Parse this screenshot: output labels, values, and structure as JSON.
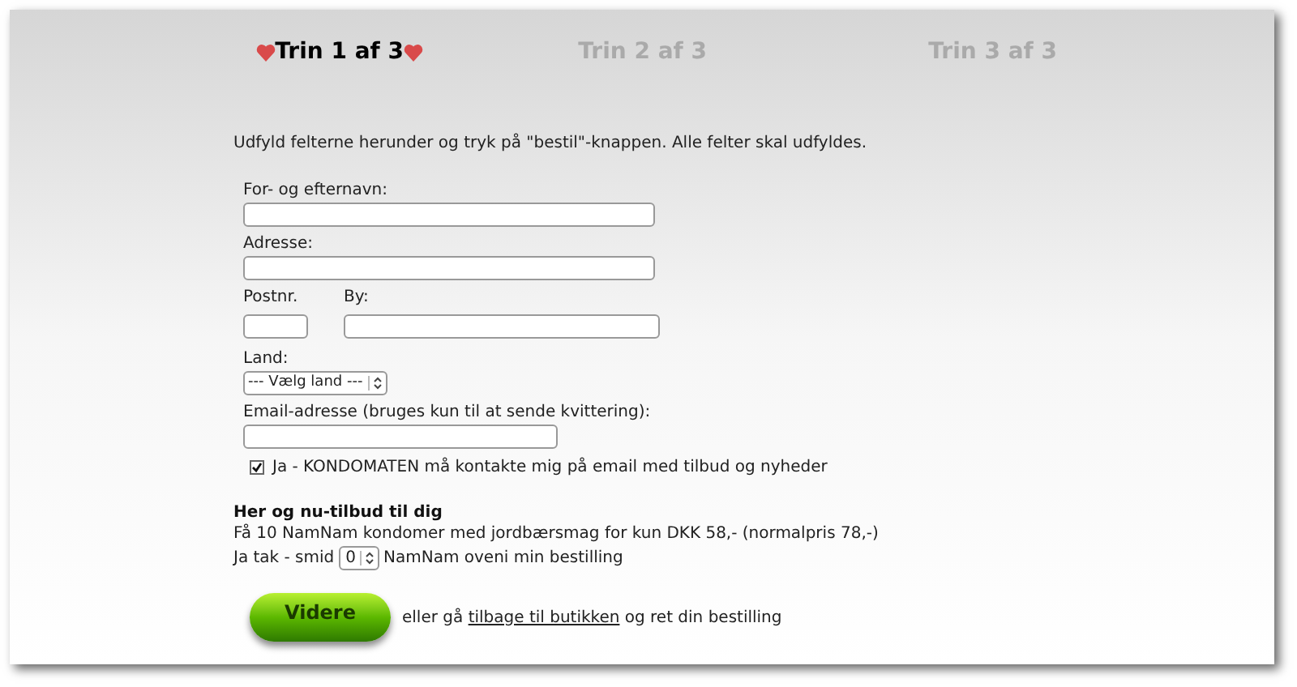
{
  "steps": [
    {
      "label": "Trin 1 af 3",
      "selected": true
    },
    {
      "label": "Trin 2 af 3",
      "selected": false
    },
    {
      "label": "Trin 3 af 3",
      "selected": false
    }
  ],
  "intro": "Udfyld felterne herunder og tryk på \"bestil\"-knappen. Alle felter skal udfyldes.",
  "form": {
    "name_label": "For- og efternavn:",
    "address_label": "Adresse:",
    "zip_label": "Postnr.",
    "city_label": "By:",
    "country_label": "Land:",
    "country_value": "--- Vælg land ---",
    "email_label": "Email-adresse (bruges kun til at sende kvittering):",
    "newsletter": {
      "label": "Ja - KONDOMATEN må kontakte mig på email med tilbud og nyheder",
      "checked": true
    }
  },
  "offer": {
    "title": "Her og nu-tilbud til dig",
    "text": "Få 10 NamNam kondomer med jordbærsmag for kun DKK 58,- (normalpris 78,-)",
    "prefix": "Ja tak - smid",
    "quantity": "0",
    "suffix": "NamNam oveni min bestilling"
  },
  "footer": {
    "button": "Videre",
    "before": "eller gå",
    "link": "tilbage til butikken",
    "after": "og ret din bestilling"
  }
}
